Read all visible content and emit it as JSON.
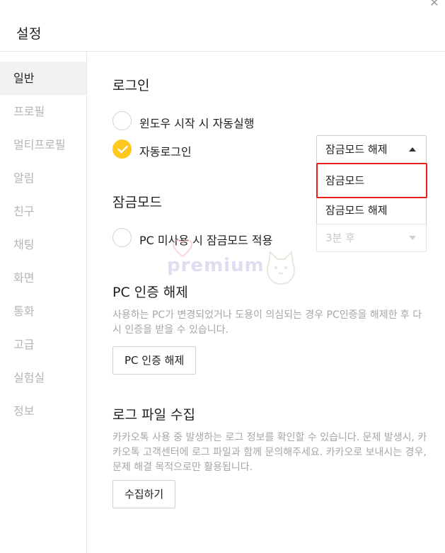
{
  "window": {
    "title": "설정"
  },
  "sidebar": {
    "items": [
      {
        "label": "일반",
        "active": true
      },
      {
        "label": "프로필"
      },
      {
        "label": "멀티프로필"
      },
      {
        "label": "알림"
      },
      {
        "label": "친구"
      },
      {
        "label": "채팅"
      },
      {
        "label": "화면"
      },
      {
        "label": "통화"
      },
      {
        "label": "고급"
      },
      {
        "label": "실험실"
      },
      {
        "label": "정보"
      }
    ]
  },
  "login": {
    "title": "로그인",
    "option_windows_start": "윈도우 시작 시 자동실행",
    "option_auto_login": "자동로그인",
    "lock_select_value": "잠금모드 해제",
    "dropdown_options": [
      "잠금모드",
      "잠금모드 해제"
    ]
  },
  "lockmode": {
    "title": "잠금모드",
    "option_idle_lock": "PC 미사용 시 잠금모드 적용",
    "idle_select_value": "3분 후"
  },
  "pc_auth": {
    "title": "PC 인증 해제",
    "description": "사용하는 PC가 변경되었거나 도용이 의심되는 경우 PC인증을 해제한 후 다시 인증을 받을 수 있습니다.",
    "button_label": "PC 인증 해제"
  },
  "log_file": {
    "title": "로그 파일 수집",
    "description": "카카오톡 사용 중 발생하는 로그 정보를 확인할 수 있습니다. 문제 발생시, 카카오톡 고객센터에 로그 파일과 함께 문의해주세요. 카카오로 보내시는 경우, 문제 해결 목적으로만 활용됩니다.",
    "button_label": "수집하기"
  },
  "watermark": {
    "text": "premium"
  },
  "colors": {
    "accent": "#ffc81e",
    "highlight": "#e8201c"
  }
}
